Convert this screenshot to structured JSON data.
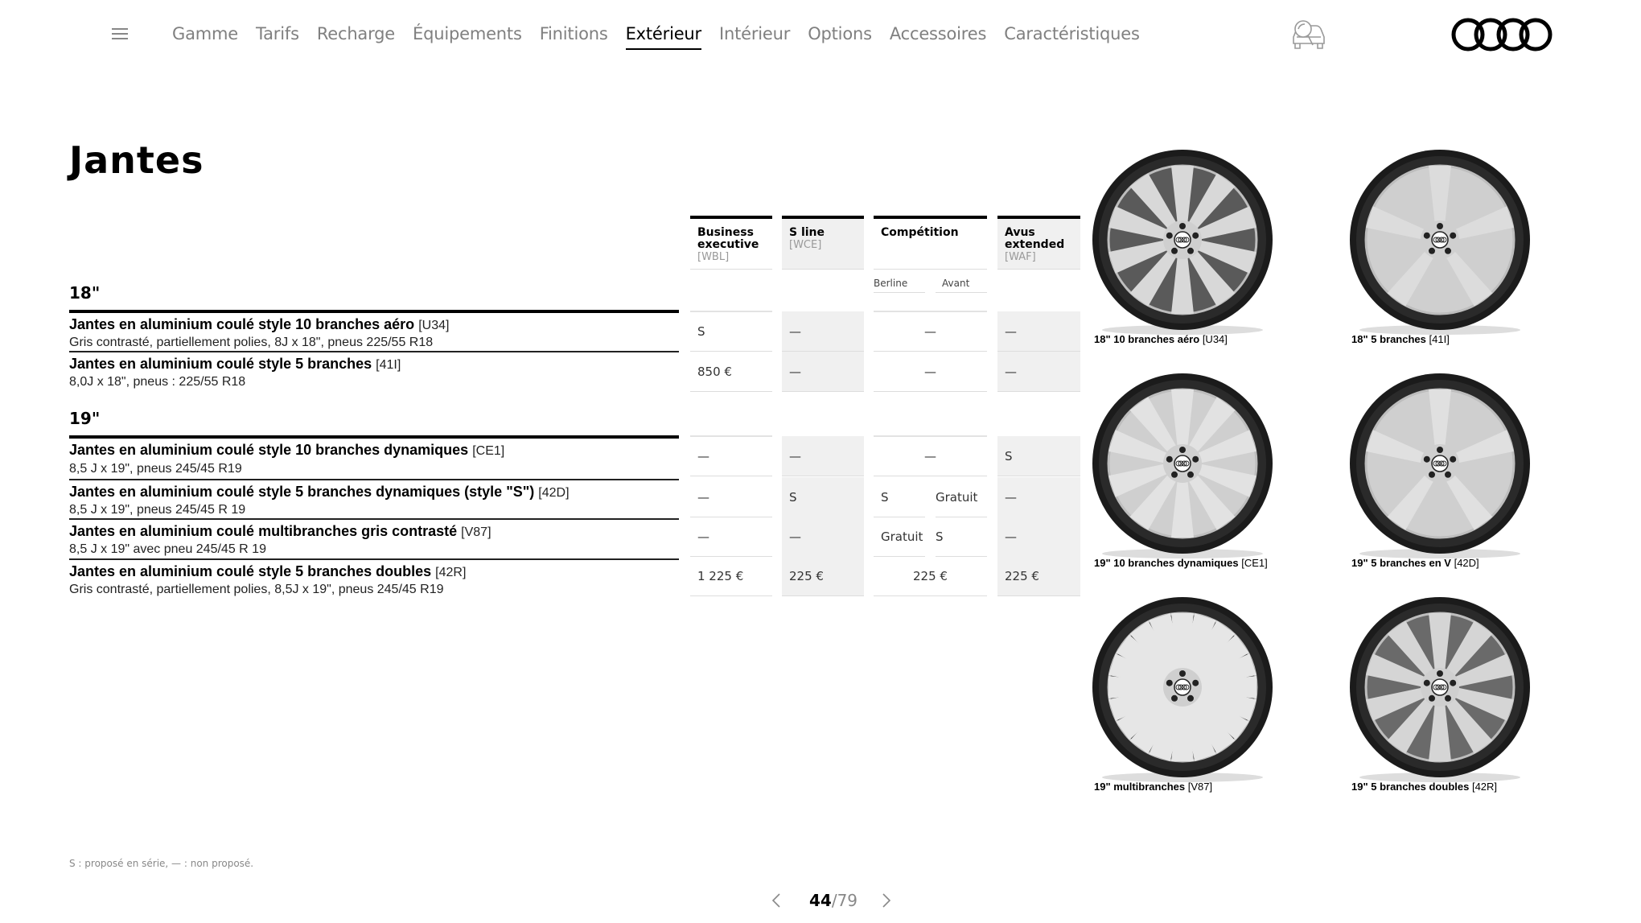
{
  "nav": {
    "items": [
      "Gamme",
      "Tarifs",
      "Recharge",
      "Équipements",
      "Finitions",
      "Extérieur",
      "Intérieur",
      "Options",
      "Accessoires",
      "Caractéristiques"
    ],
    "active": "Extérieur",
    "menu_icon": "hamburger-icon",
    "search_icon": "car-search-icon",
    "logo": "audi-rings-logo"
  },
  "page": {
    "title": "Jantes"
  },
  "columns": [
    {
      "name": "Business executive",
      "code": "[WBL]"
    },
    {
      "name": "S line",
      "code": "[WCE]"
    },
    {
      "name": "Compétition",
      "code": "",
      "sub": [
        "Berline",
        "Avant"
      ]
    },
    {
      "name": "Avus extended",
      "code": "[WAF]"
    }
  ],
  "sections": [
    {
      "label": "18\"",
      "rows": [
        {
          "title": "Jantes en aluminium coulé style 10 branches aéro",
          "code": "[U34]",
          "desc": "Gris contrasté, partiellement polies, 8J x 18\", pneus 225/55 R18",
          "values": {
            "business": "S",
            "sline": "—",
            "competition": "—",
            "avus": "—"
          }
        },
        {
          "title": "Jantes en aluminium coulé style 5 branches",
          "code": "[41I]",
          "desc": "8,0J x 18\", pneus : 225/55 R18",
          "values": {
            "business": "850 €",
            "sline": "—",
            "competition": "—",
            "avus": "—"
          }
        }
      ]
    },
    {
      "label": "19\"",
      "rows": [
        {
          "title": "Jantes en aluminium coulé style 10 branches dynamiques",
          "code": "[CE1]",
          "desc": "8,5 J x 19\", pneus 245/45 R19",
          "values": {
            "business": "—",
            "sline": "—",
            "competition": "—",
            "avus": "S"
          }
        },
        {
          "title": "Jantes en aluminium coulé style 5 branches dynamiques (style \"S\")",
          "code": "[42D]",
          "desc": "8,5 J x 19\", pneus 245/45 R 19",
          "values": {
            "business": "—",
            "sline": "S",
            "competition_berline": "S",
            "competition_avant": "Gratuit",
            "avus": "—"
          }
        },
        {
          "title": "Jantes en aluminium coulé multibranches gris contrasté",
          "code": "[V87]",
          "desc": "8,5 J x 19\" avec pneu 245/45 R 19",
          "values": {
            "business": "—",
            "sline": "—",
            "competition_berline": "Gratuit",
            "competition_avant": "S",
            "avus": "—"
          }
        },
        {
          "title": "Jantes en aluminium coulé style 5 branches doubles",
          "code": "[42R]",
          "desc": "Gris contrasté, partiellement polies, 8,5J x 19\", pneus 245/45 R19",
          "values": {
            "business": "1 225 €",
            "sline": "225 €",
            "competition": "225 €",
            "avus": "225 €"
          }
        }
      ]
    }
  ],
  "wheels": [
    {
      "label": "18\" 10 branches aéro",
      "code": "[U34]"
    },
    {
      "label": "18\" 5 branches",
      "code": "[41I]"
    },
    {
      "label": "19\" 10 branches dynamiques",
      "code": "[CE1]"
    },
    {
      "label": "19\" 5 branches en V",
      "code": "[42D]"
    },
    {
      "label": "19\" multibranches",
      "code": "[V87]"
    },
    {
      "label": "19\" 5 branches doubles",
      "code": "[42R]"
    }
  ],
  "footnote": "S : proposé en série, — : non proposé.",
  "pager": {
    "current": "44",
    "total": "/79"
  }
}
